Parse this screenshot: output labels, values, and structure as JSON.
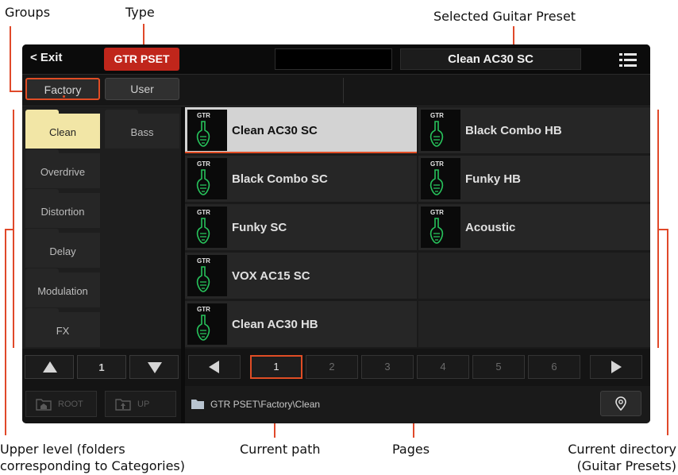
{
  "annotations": {
    "groups": "Groups",
    "type": "Type",
    "selected_preset": "Selected Guitar Preset",
    "upper_level_1": "Upper level (folders",
    "upper_level_2": "corresponding to Categories)",
    "current_path": "Current path",
    "pages": "Pages",
    "current_dir_1": "Current directory",
    "current_dir_2": "(Guitar Presets)"
  },
  "topbar": {
    "exit_label": "< Exit",
    "type_label": "GTR PSET",
    "selected_preset": "Clean AC30 SC",
    "menu_icon": "hamburger-menu-icon"
  },
  "groups": {
    "factory": "Factory",
    "user": "User",
    "selected": "Factory"
  },
  "folders": {
    "col1": [
      "Clean",
      "Overdrive",
      "Distortion",
      "Delay",
      "Modulation",
      "FX"
    ],
    "col2": [
      "Bass"
    ],
    "active": "Clean"
  },
  "presets": {
    "type_tag": "GTR",
    "items": [
      "Clean AC30 SC",
      "Black Combo HB",
      "Black Combo SC",
      "Funky HB",
      "Funky SC",
      "Acoustic",
      "VOX AC15 SC",
      "Clean AC30 HB"
    ],
    "selected": "Clean AC30 SC"
  },
  "folder_pager": {
    "page": "1"
  },
  "pages": {
    "items": [
      "1",
      "2",
      "3",
      "4",
      "5",
      "6"
    ],
    "active": "1"
  },
  "bottom": {
    "root_label": "ROOT",
    "up_label": "UP",
    "path": "GTR PSET\\Factory\\Clean"
  },
  "colors": {
    "accent": "#e04d25",
    "type_badge": "#c0261b",
    "active_folder": "#f2e6a6",
    "guitar_icon": "#27c25b",
    "annotation_line": "#e0492a"
  }
}
